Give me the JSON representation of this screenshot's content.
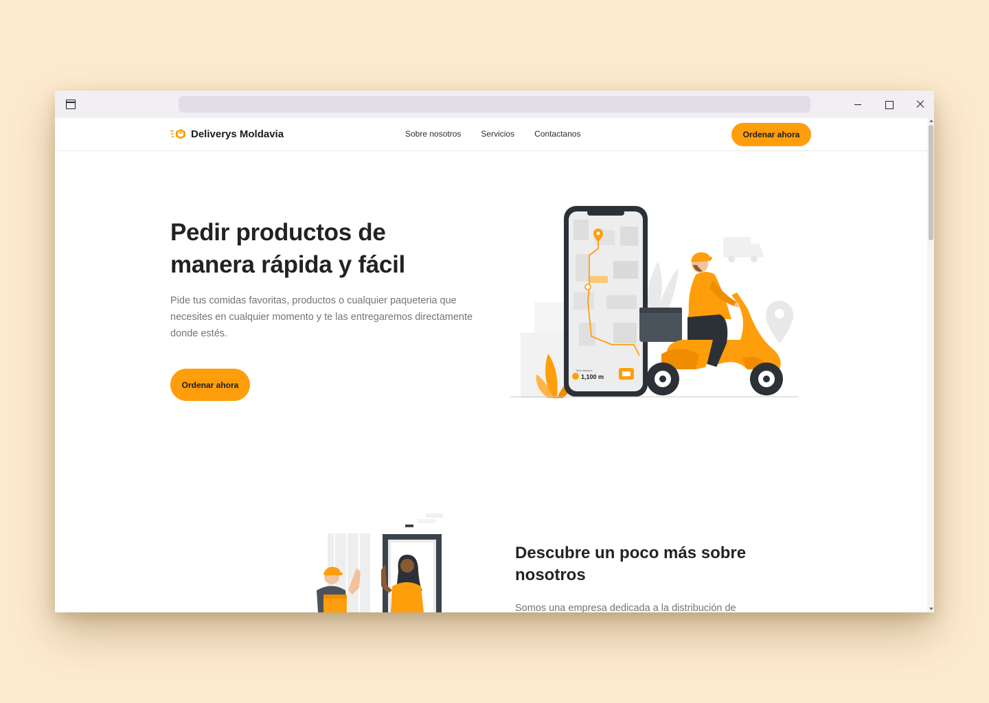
{
  "brand": {
    "name": "Deliverys Moldavia",
    "logo_icon": "delivery-box-icon"
  },
  "nav": {
    "links": [
      "Sobre nosotros",
      "Servicios",
      "Contactanos"
    ],
    "cta_label": "Ordenar ahora"
  },
  "hero": {
    "title": "Pedir productos de manera rápida y fácil",
    "description": "Pide tus comidas favoritas, productos o cualquier paqueteria que necesites en cualquier momento y te las entregaremos directamente donde estés.",
    "cta_label": "Ordenar ahora",
    "phone_label": "Total distance",
    "phone_distance": "1,100 m"
  },
  "about": {
    "title": "Descubre un poco más sobre nosotros",
    "description": "Somos una empresa dedicada a la distribución de"
  },
  "colors": {
    "accent": "#ff9e0b",
    "page_background": "#fdebd0",
    "text_dark": "#222222",
    "text_muted": "#747474"
  }
}
